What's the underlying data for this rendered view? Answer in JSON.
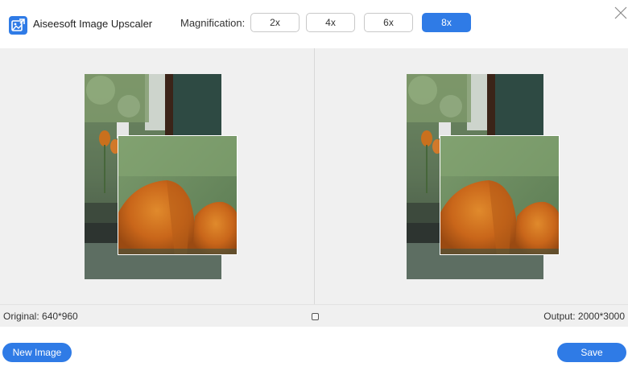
{
  "header": {
    "app_name": "Aiseesoft Image Upscaler",
    "magnification_label": "Magnification:",
    "options": [
      "2x",
      "4x",
      "6x",
      "8x"
    ],
    "selected": "8x"
  },
  "info": {
    "original": "Original: 640*960",
    "output": "Output: 2000*3000"
  },
  "footer": {
    "new_image_label": "New Image",
    "save_label": "Save"
  },
  "colors": {
    "accent": "#2f7be6",
    "panel_bg": "#f0f0f0"
  },
  "icons": {
    "logo": "image-upscale-icon",
    "close": "close-icon",
    "handle": "square-handle-icon"
  }
}
